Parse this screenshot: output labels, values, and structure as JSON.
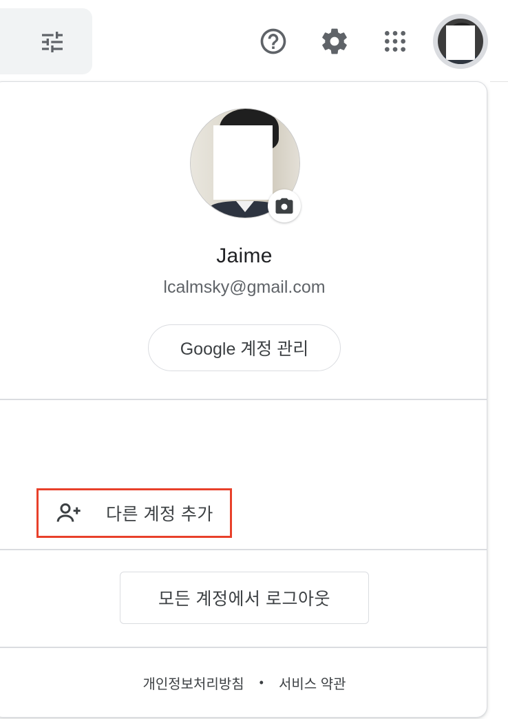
{
  "top_bar": {
    "filter_icon": "tune-icon",
    "help_icon": "help-circle-icon",
    "settings_icon": "gear-icon",
    "apps_icon": "apps-grid-icon",
    "avatar_icon": "account-avatar"
  },
  "account_menu": {
    "name": "Jaime",
    "email": "lcalmsky@gmail.com",
    "manage_account_label": "Google 계정 관리",
    "camera_icon": "camera-icon",
    "add_account_label": "다른 계정 추가",
    "add_account_icon": "person-add-icon",
    "sign_out_all_label": "모든 계정에서 로그아웃",
    "footer": {
      "privacy_label": "개인정보처리방침",
      "separator": "•",
      "terms_label": "서비스 약관"
    }
  },
  "colors": {
    "highlight_border": "#e8402a",
    "icon_gray": "#5f6368",
    "text_dark": "#202124",
    "divider": "#dadce0"
  }
}
